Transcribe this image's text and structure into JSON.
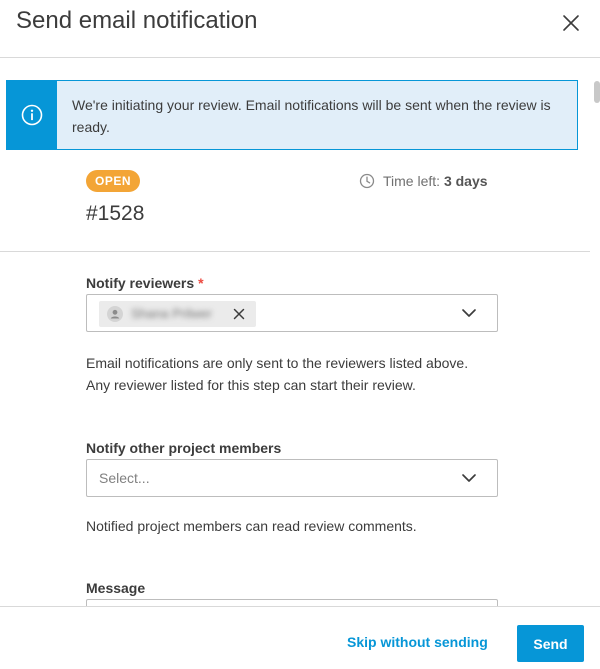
{
  "dialog": {
    "title": "Send email notification"
  },
  "banner": {
    "text": "We're initiating your review. Email notifications will be sent when the review is ready."
  },
  "review": {
    "status": "OPEN",
    "time_left_label": "Time left:",
    "time_left_value": "3 days",
    "id": "#1528"
  },
  "notify_reviewers": {
    "label": "Notify reviewers",
    "required_mark": "*",
    "selected": [
      "Shana Prilwer"
    ],
    "help": "Email notifications are only sent to the reviewers listed above. Any reviewer listed for this step can start their review."
  },
  "notify_members": {
    "label": "Notify other project members",
    "placeholder": "Select...",
    "help": "Notified project members can read review comments."
  },
  "message": {
    "label": "Message"
  },
  "footer": {
    "skip_label": "Skip without sending",
    "send_label": "Send"
  },
  "colors": {
    "accent": "#0696d7",
    "status_open": "#f3a536",
    "required": "#ec4a41",
    "banner_bg": "#e1eef9"
  }
}
